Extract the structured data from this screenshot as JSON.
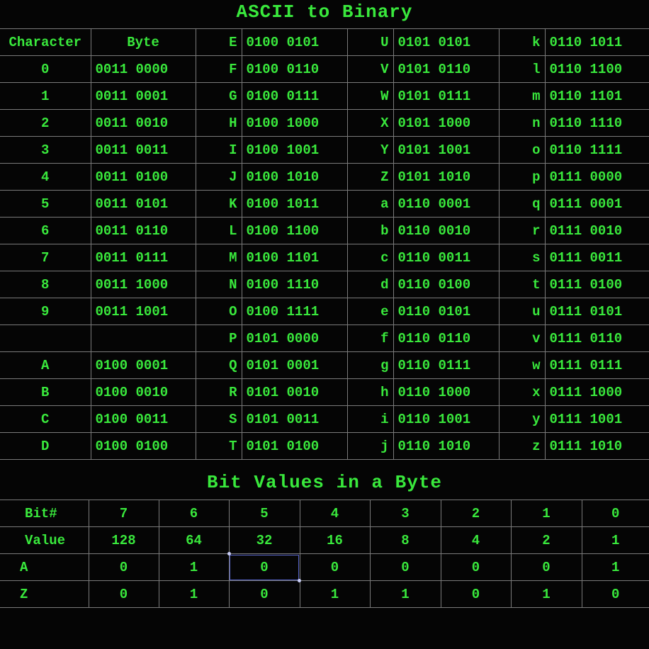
{
  "title": "ASCII to Binary",
  "ascii_table": {
    "headers": [
      "Character",
      "Byte"
    ],
    "rows": [
      [
        "",
        "",
        "E",
        "0100 0101",
        "U",
        "0101 0101",
        "k",
        "0110 1011"
      ],
      [
        "0",
        "0011 0000",
        "F",
        "0100 0110",
        "V",
        "0101 0110",
        "l",
        "0110 1100"
      ],
      [
        "1",
        "0011 0001",
        "G",
        "0100 0111",
        "W",
        "0101 0111",
        "m",
        "0110 1101"
      ],
      [
        "2",
        "0011 0010",
        "H",
        "0100 1000",
        "X",
        "0101 1000",
        "n",
        "0110 1110"
      ],
      [
        "3",
        "0011 0011",
        "I",
        "0100 1001",
        "Y",
        "0101 1001",
        "o",
        "0110 1111"
      ],
      [
        "4",
        "0011 0100",
        "J",
        "0100 1010",
        "Z",
        "0101 1010",
        "p",
        "0111 0000"
      ],
      [
        "5",
        "0011 0101",
        "K",
        "0100 1011",
        "a",
        "0110 0001",
        "q",
        "0111 0001"
      ],
      [
        "6",
        "0011 0110",
        "L",
        "0100 1100",
        "b",
        "0110 0010",
        "r",
        "0111 0010"
      ],
      [
        "7",
        "0011 0111",
        "M",
        "0100 1101",
        "c",
        "0110 0011",
        "s",
        "0111 0011"
      ],
      [
        "8",
        "0011 1000",
        "N",
        "0100 1110",
        "d",
        "0110 0100",
        "t",
        "0111 0100"
      ],
      [
        "9",
        "0011 1001",
        "O",
        "0100 1111",
        "e",
        "0110 0101",
        "u",
        "0111 0101"
      ],
      [
        "",
        "",
        "P",
        "0101 0000",
        "f",
        "0110 0110",
        "v",
        "0111 0110"
      ],
      [
        "A",
        "0100 0001",
        "Q",
        "0101 0001",
        "g",
        "0110 0111",
        "w",
        "0111 0111"
      ],
      [
        "B",
        "0100 0010",
        "R",
        "0101 0010",
        "h",
        "0110 1000",
        "x",
        "0111 1000"
      ],
      [
        "C",
        "0100 0011",
        "S",
        "0101 0011",
        "i",
        "0110 1001",
        "y",
        "0111 1001"
      ],
      [
        "D",
        "0100 0100",
        "T",
        "0101 0100",
        "j",
        "0110 1010",
        "z",
        "0111 1010"
      ]
    ]
  },
  "bit_title": "Bit Values in a Byte",
  "bit_table": {
    "rows": [
      [
        "Bit#",
        "7",
        "6",
        "5",
        "4",
        "3",
        "2",
        "1",
        "0"
      ],
      [
        "Value",
        "128",
        "64",
        "32",
        "16",
        "8",
        "4",
        "2",
        "1"
      ],
      [
        "A",
        "0",
        "1",
        "0",
        "0",
        "0",
        "0",
        "0",
        "1"
      ],
      [
        "Z",
        "0",
        "1",
        "0",
        "1",
        "1",
        "0",
        "1",
        "0"
      ]
    ],
    "selected_cell": {
      "row": 2,
      "col": 3
    }
  },
  "colors": {
    "text": "#39e83c",
    "background": "#050505",
    "grid": "#7a7a7a",
    "selection": "#5864c9"
  }
}
